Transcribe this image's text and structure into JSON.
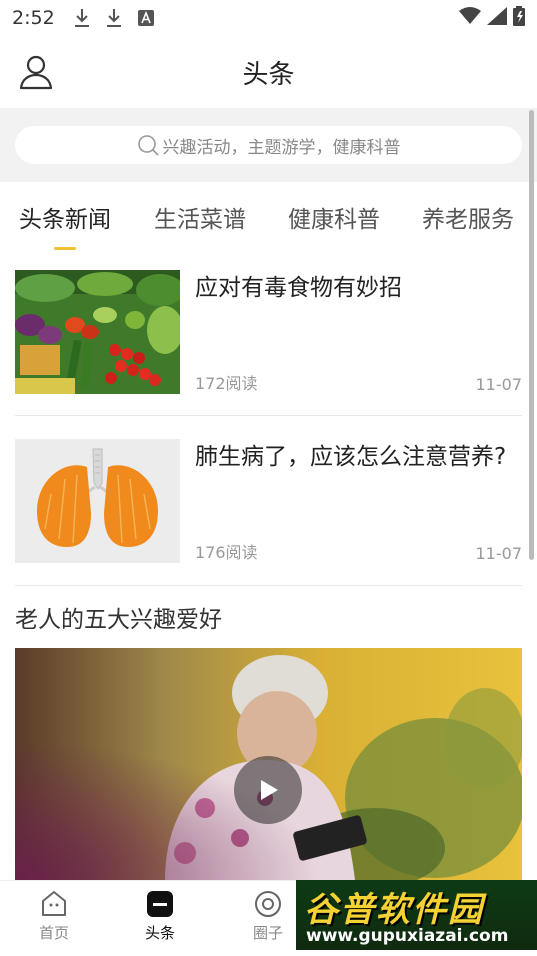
{
  "status_bar": {
    "time": "2:52"
  },
  "header": {
    "title": "头条"
  },
  "search": {
    "placeholder": "兴趣活动，主题游学，健康科普"
  },
  "tabs": [
    {
      "label": "头条新闻",
      "active": true
    },
    {
      "label": "生活菜谱",
      "active": false
    },
    {
      "label": "健康科普",
      "active": false
    },
    {
      "label": "养老服务",
      "active": false
    }
  ],
  "news": [
    {
      "title": "应对有毒食物有妙招",
      "reads": "172阅读",
      "date": "11-07"
    },
    {
      "title": "肺生病了，应该怎么注意营养?",
      "reads": "176阅读",
      "date": "11-07"
    }
  ],
  "video_article": {
    "title": "老人的五大兴趣爱好"
  },
  "bottom_nav": [
    {
      "label": "首页",
      "icon": "home-icon",
      "active": false
    },
    {
      "label": "头条",
      "icon": "news-icon",
      "active": true
    },
    {
      "label": "圈子",
      "icon": "circle-icon",
      "active": false
    }
  ],
  "watermark": {
    "brand": "谷普软件园",
    "url": "www.gupuxiazai.com"
  },
  "colors": {
    "accent": "#f1c232",
    "search_band": "#f2f2f2",
    "watermark_text": "#f4d233"
  }
}
